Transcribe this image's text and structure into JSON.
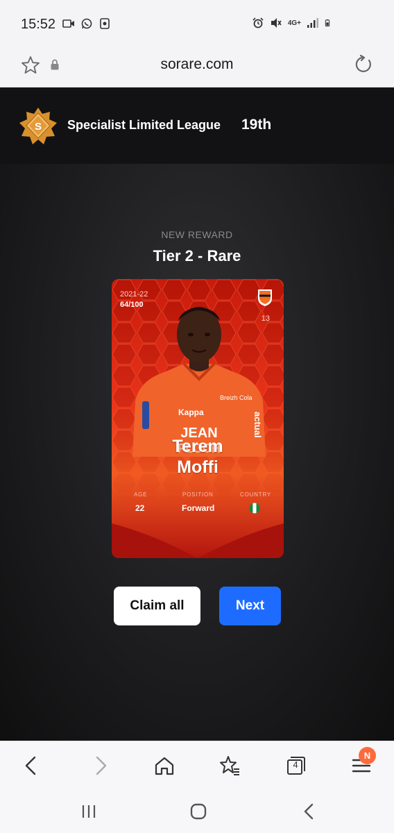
{
  "status_bar": {
    "time": "15:52",
    "left_icons": [
      "video-call-icon",
      "whatsapp-icon",
      "screenshot-icon"
    ],
    "right_icons": [
      "alarm-icon",
      "mute-icon",
      "4g-icon",
      "signal-icon",
      "battery-icon"
    ],
    "network_label": "4G+"
  },
  "browser": {
    "url": "sorare.com",
    "tabs_count": "4",
    "notification_badge": "N"
  },
  "league": {
    "badge_letter": "S",
    "name": "Specialist Limited League",
    "rank": "19th"
  },
  "reward": {
    "kicker": "NEW REWARD",
    "title": "Tier 2 - Rare"
  },
  "card": {
    "season": "2021-22",
    "serial": "64/100",
    "shirt_number": "13",
    "first_name": "Terem",
    "last_name": "Moffi",
    "age_label": "AGE",
    "age": "22",
    "position_label": "POSITION",
    "position": "Forward",
    "country_label": "COUNTRY",
    "country_flag": "nigeria-flag-icon",
    "jersey_sponsor_1": "JEAN",
    "jersey_sponsor_2": "FLOCH",
    "jersey_side_text": "actual",
    "jersey_chest_text": "Breizh Cola",
    "colors": {
      "rare_red": "#e9341a",
      "rare_dark": "#b3160e"
    }
  },
  "actions": {
    "claim_all": "Claim all",
    "next": "Next"
  },
  "colors": {
    "next_button": "#1e6cff",
    "league_gold": "#d8912c",
    "notif": "#ff6a3c"
  }
}
